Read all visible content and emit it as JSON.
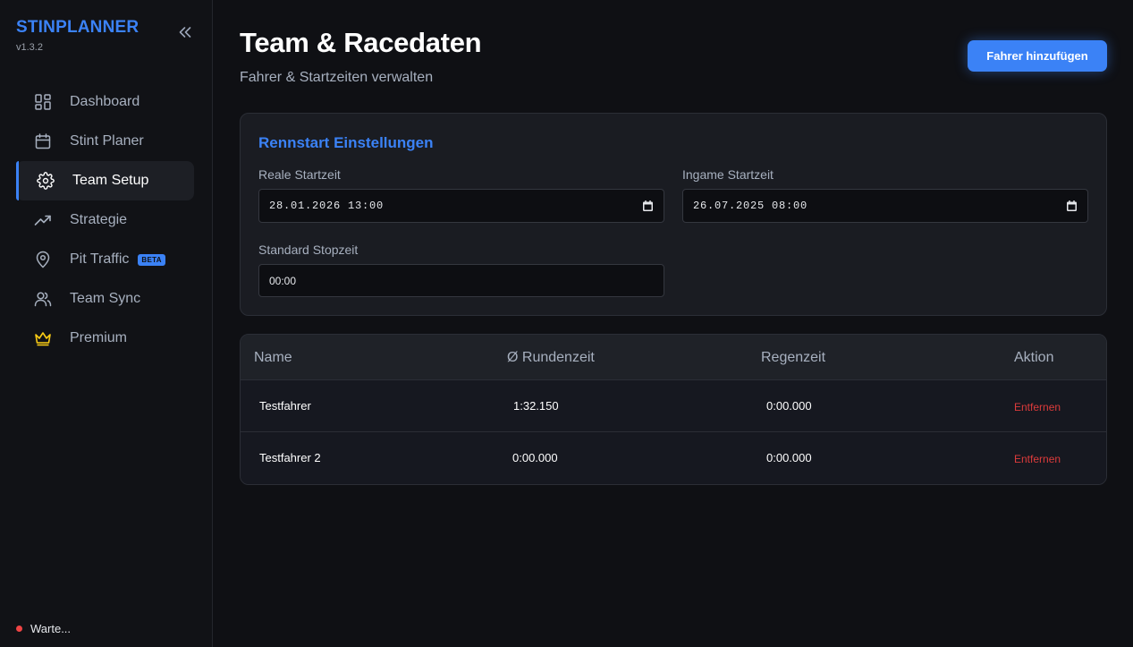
{
  "app": {
    "name": "STINPLANNER",
    "version": "v1.3.2"
  },
  "sidebar": {
    "items": [
      {
        "label": "Dashboard",
        "icon": "dashboard-icon"
      },
      {
        "label": "Stint Planer",
        "icon": "calendar-icon"
      },
      {
        "label": "Team Setup",
        "icon": "gear-icon",
        "active": true
      },
      {
        "label": "Strategie",
        "icon": "trending-up-icon"
      },
      {
        "label": "Pit Traffic",
        "icon": "map-pin-icon",
        "badge": "BETA"
      },
      {
        "label": "Team Sync",
        "icon": "users-icon"
      },
      {
        "label": "Premium",
        "icon": "crown-icon"
      }
    ],
    "status": "Warte..."
  },
  "header": {
    "title": "Team & Racedaten",
    "subtitle": "Fahrer & Startzeiten verwalten",
    "add_driver_label": "Fahrer hinzufügen"
  },
  "settings": {
    "title": "Rennstart Einstellungen",
    "real_start_label": "Reale Startzeit",
    "real_start_value": "28.01.2026 13:00",
    "ingame_start_label": "Ingame Startzeit",
    "ingame_start_value": "26.07.2025 08:00",
    "stop_time_label": "Standard Stopzeit",
    "stop_time_value": "00:00"
  },
  "table": {
    "headers": [
      "Name",
      "Ø Rundenzeit",
      "Regenzeit",
      "Aktion"
    ],
    "rows": [
      {
        "name": "Testfahrer",
        "lap": "1:32.150",
        "rain": "0:00.000",
        "action": "Entfernen"
      },
      {
        "name": "Testfahrer 2",
        "lap": "0:00.000",
        "rain": "0:00.000",
        "action": "Entfernen"
      }
    ]
  },
  "colors": {
    "accent": "#3b82f6",
    "danger": "#dc3b3b",
    "premium": "#facc15",
    "status": "#ef4444"
  }
}
